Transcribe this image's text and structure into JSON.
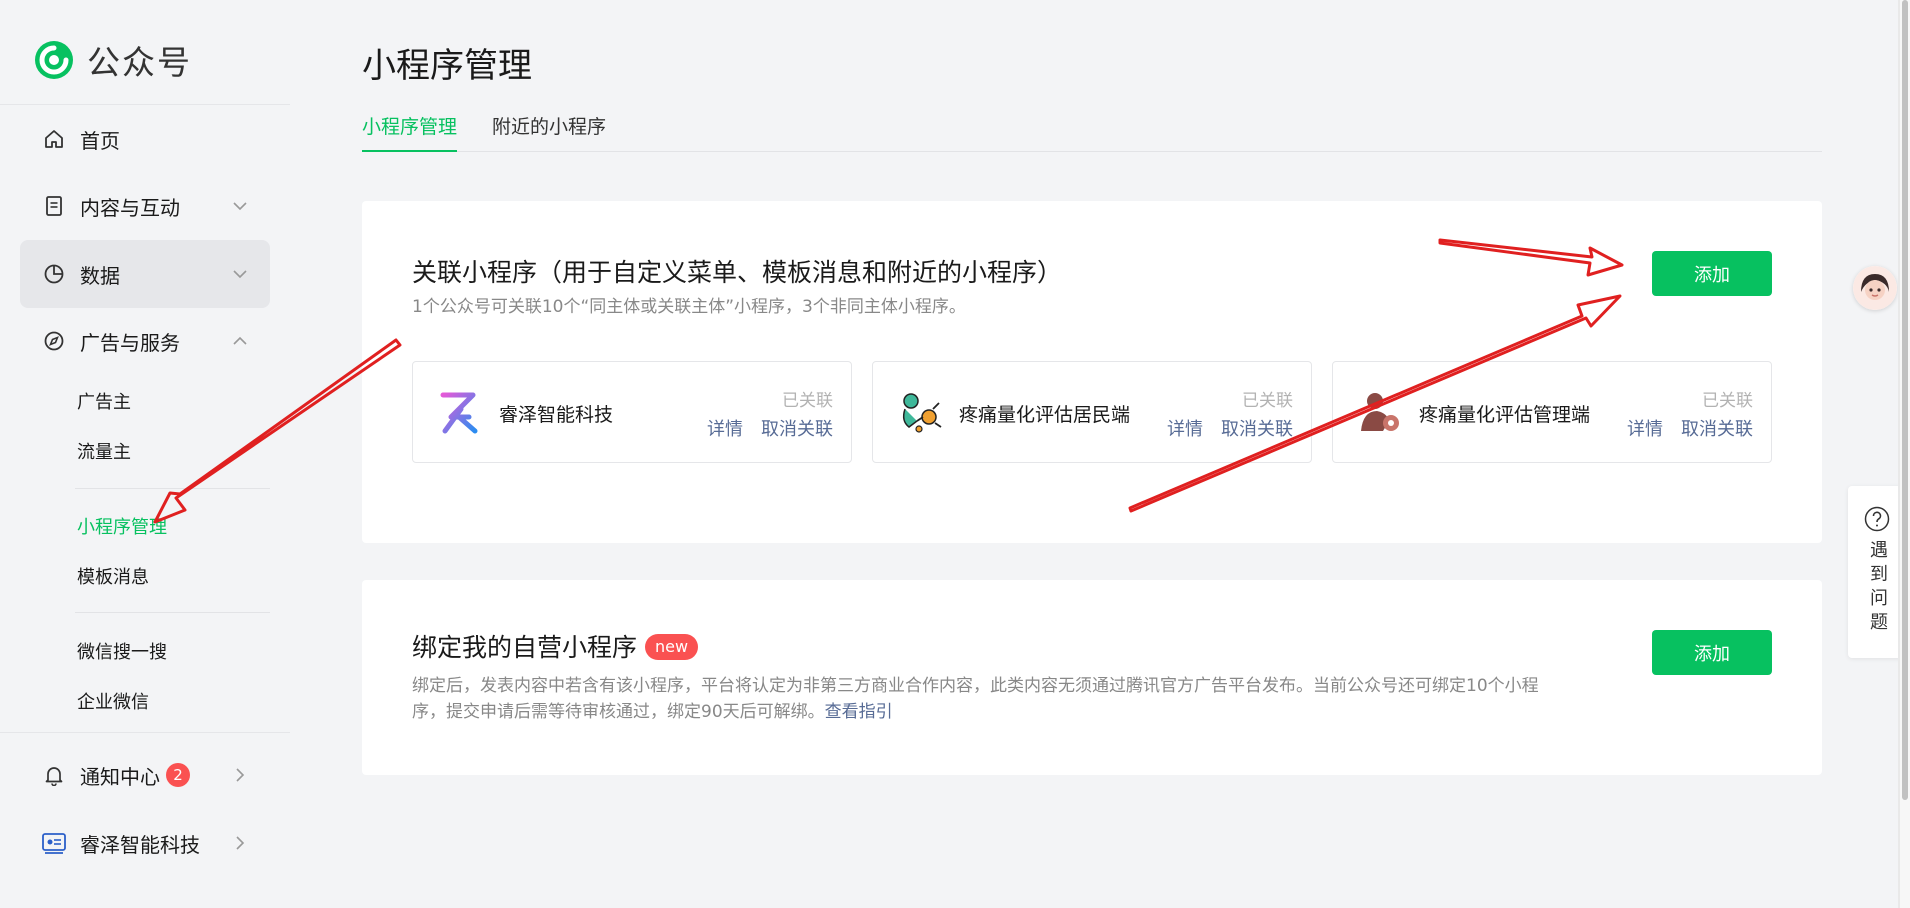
{
  "app": {
    "title": "公众号"
  },
  "sidebar": {
    "home": "首页",
    "content": "内容与互动",
    "data": "数据",
    "ads": "广告与服务",
    "sub": {
      "advertiser": "广告主",
      "publisher": "流量主",
      "miniprogram": "小程序管理",
      "template": "模板消息",
      "wxsearch": "微信搜一搜",
      "wework": "企业微信"
    },
    "notify": {
      "label": "通知中心",
      "count": "2"
    },
    "account": "睿泽智能科技"
  },
  "page": {
    "title": "小程序管理",
    "tabs": [
      "小程序管理",
      "附近的小程序"
    ]
  },
  "linked": {
    "title": "关联小程序（用于自定义菜单、模板消息和附近的小程序）",
    "desc": "1个公众号可关联10个“同主体或关联主体”小程序，3个非同主体小程序。",
    "add": "添加",
    "items": [
      {
        "name": "睿泽智能科技",
        "status": "已关联",
        "detail": "详情",
        "unlink": "取消关联"
      },
      {
        "name": "疼痛量化评估居民端",
        "status": "已关联",
        "detail": "详情",
        "unlink": "取消关联"
      },
      {
        "name": "疼痛量化评估管理端",
        "status": "已关联",
        "detail": "详情",
        "unlink": "取消关联"
      }
    ]
  },
  "bind": {
    "title": "绑定我的自营小程序",
    "badge": "new",
    "desc": "绑定后，发表内容中若含有该小程序，平台将认定为非第三方商业合作内容，此类内容无须通过腾讯官方广告平台发布。当前公众号还可绑定10个小程序，提交申请后需等待审核通过，绑定90天后可解绑。",
    "guide": "查看指引",
    "add": "添加"
  },
  "help": {
    "label": "遇到问题"
  },
  "colors": {
    "accent": "#07c160",
    "link": "#576b95",
    "badge": "#fa5151",
    "annotation": "#e02020"
  }
}
